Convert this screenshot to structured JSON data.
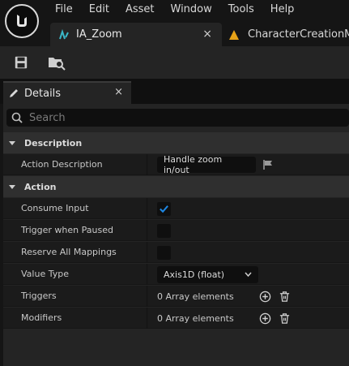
{
  "menu": [
    "File",
    "Edit",
    "Asset",
    "Window",
    "Tools",
    "Help"
  ],
  "tabs": {
    "active": {
      "label": "IA_Zoom",
      "close": "×"
    },
    "other": {
      "label": "CharacterCreationMa"
    }
  },
  "toolbar": {
    "save_icon": "save-icon",
    "browse_icon": "browse-to-asset-icon"
  },
  "details": {
    "tab_label": "Details",
    "close": "×",
    "search_placeholder": "Search"
  },
  "sections": {
    "description": {
      "title": "Description",
      "action_description": {
        "label": "Action Description",
        "value": "Handle zoom in/out"
      }
    },
    "action": {
      "title": "Action",
      "consume_input": {
        "label": "Consume Input",
        "checked": true
      },
      "trigger_when_paused": {
        "label": "Trigger when Paused",
        "checked": false
      },
      "reserve_all_mappings": {
        "label": "Reserve All Mappings",
        "checked": false
      },
      "value_type": {
        "label": "Value Type",
        "value": "Axis1D (float)"
      },
      "triggers": {
        "label": "Triggers",
        "value": "0 Array elements"
      },
      "modifiers": {
        "label": "Modifiers",
        "value": "0 Array elements"
      }
    }
  },
  "colors": {
    "accent": "#1e88e5",
    "tab_icon_orange": "#e8a317",
    "tab_icon_teal": "#3ab7c8"
  }
}
